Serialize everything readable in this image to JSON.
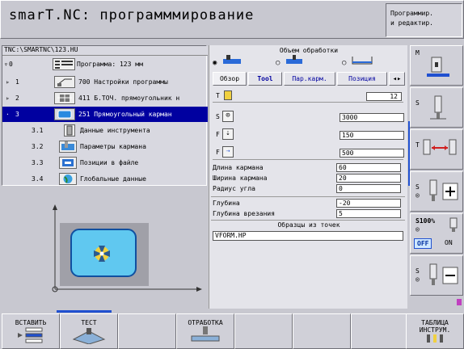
{
  "header": {
    "title": "smarT.NC: программмирование",
    "mode_line1": "Программир.",
    "mode_line2": "и редактир."
  },
  "tree": {
    "path": "TNC:\\SMARTNC\\123.HU",
    "rows": [
      {
        "num": "0",
        "label": "Программа: 123 мм"
      },
      {
        "num": "1",
        "label": "700 Настройки программы"
      },
      {
        "num": "2",
        "label": "411 Б.ТОЧ. прямоугольник н"
      },
      {
        "num": "3",
        "label": "251 Прямоугольный карман"
      },
      {
        "num": "3.1",
        "label": "Данные инструмента"
      },
      {
        "num": "3.2",
        "label": "Параметры кармана"
      },
      {
        "num": "3.3",
        "label": "Позиции в файле"
      },
      {
        "num": "3.4",
        "label": "Глобальные данные"
      }
    ]
  },
  "form": {
    "scope_title": "Объем обработки",
    "tabs": [
      "Обзор",
      "Tool",
      "Пар.карм.",
      "Позиция"
    ],
    "tool_value": "12",
    "spindle_value": "3000",
    "feed_plunge_value": "150",
    "feed_mill_value": "500",
    "labels": {
      "t": "T",
      "s": "S",
      "f1": "F",
      "f2": "F",
      "length": "Длина кармана",
      "width": "Ширина кармана",
      "radius": "Радиус угла",
      "depth": "Глубина",
      "plunge": "Глубина врезания",
      "patterns": "Образцы из точек"
    },
    "values": {
      "length": "60",
      "width": "20",
      "radius": "0",
      "depth": "-20",
      "plunge": "5"
    },
    "pattern_value": "VFORM.HP"
  },
  "softkeys_right": {
    "m": "M",
    "s": "S",
    "t": "T",
    "s_plus": "S",
    "override_label": "S100%",
    "off": "OFF",
    "on": "ON",
    "s_minus": "S"
  },
  "softkeys_bottom": {
    "insert": "ВСТАВИТЬ",
    "test": "ТЕСТ",
    "process": "ОТРАБОТКА",
    "table_line1": "ТАБЛИЦА",
    "table_line2": "ИНСТРУМ."
  },
  "colors": {
    "selection": "#0000a0",
    "accent_blue": "#2050d0",
    "preview_fill": "#60c8f0"
  }
}
